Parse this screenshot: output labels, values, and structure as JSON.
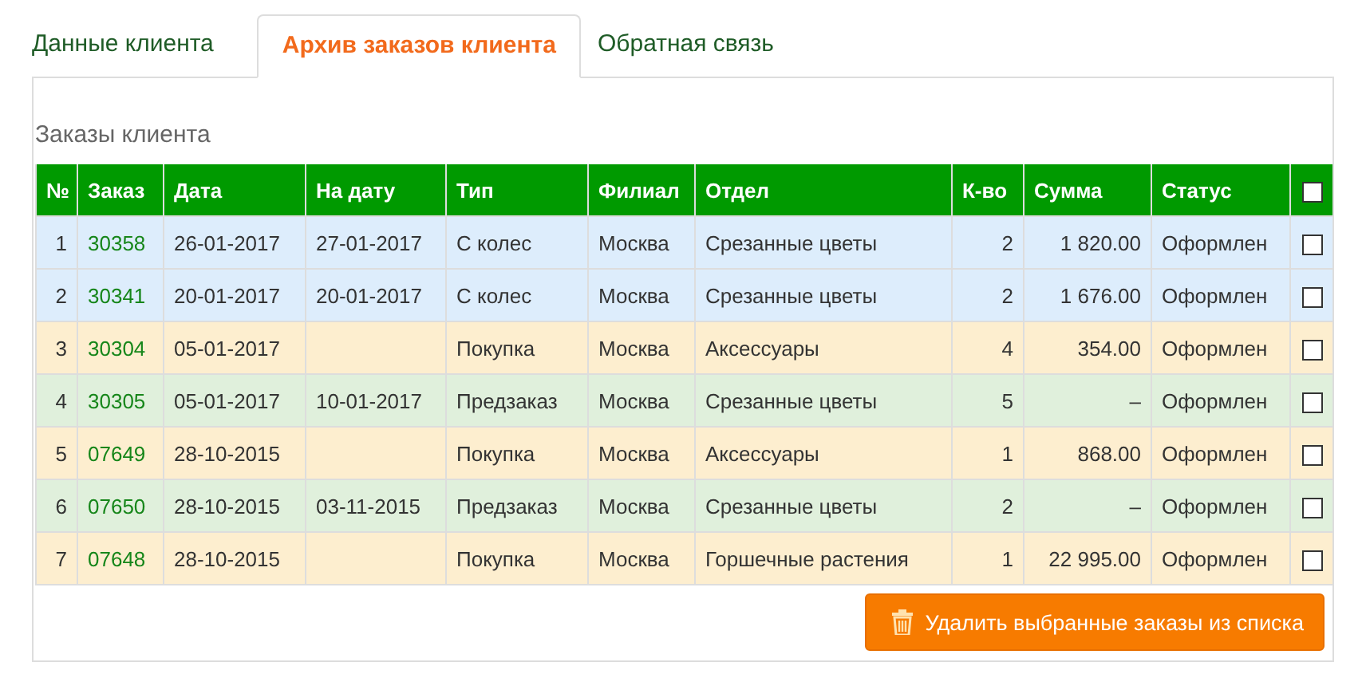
{
  "tabs": [
    {
      "label": "Данные клиента",
      "selected": false
    },
    {
      "label": "Архив заказов клиента",
      "selected": true
    },
    {
      "label": "Обратная связь",
      "selected": false
    }
  ],
  "panel": {
    "title": "Заказы клиента",
    "table": {
      "columns": [
        "№",
        "Заказ",
        "Дата",
        "На дату",
        "Тип",
        "Филиал",
        "Отдел",
        "К-во",
        "Сумма",
        "Статус"
      ],
      "select_all": {
        "checked": false
      },
      "rows": [
        {
          "cells": [
            "1",
            "30358",
            "26-01-2017",
            "27-01-2017",
            "С колес",
            "Москва",
            "Срезанные цветы",
            "2",
            "1 820.00",
            "Оформлен"
          ],
          "color": "#ddedfc",
          "checked": false
        },
        {
          "cells": [
            "2",
            "30341",
            "20-01-2017",
            "20-01-2017",
            "С колес",
            "Москва",
            "Срезанные цветы",
            "2",
            "1 676.00",
            "Оформлен"
          ],
          "color": "#ddedfc",
          "checked": false
        },
        {
          "cells": [
            "3",
            "30304",
            "05-01-2017",
            "",
            "Покупка",
            "Москва",
            "Аксессуары",
            "4",
            "354.00",
            "Оформлен"
          ],
          "color": "#fdeecf",
          "checked": false
        },
        {
          "cells": [
            "4",
            "30305",
            "05-01-2017",
            "10-01-2017",
            "Предзаказ",
            "Москва",
            "Срезанные цветы",
            "5",
            "–",
            "Оформлен"
          ],
          "color": "#e0f0dc",
          "checked": false
        },
        {
          "cells": [
            "5",
            "07649",
            "28-10-2015",
            "",
            "Покупка",
            "Москва",
            "Аксессуары",
            "1",
            "868.00",
            "Оформлен"
          ],
          "color": "#fdeecf",
          "checked": false
        },
        {
          "cells": [
            "6",
            "07650",
            "28-10-2015",
            "03-11-2015",
            "Предзаказ",
            "Москва",
            "Срезанные цветы",
            "2",
            "–",
            "Оформлен"
          ],
          "color": "#e0f0dc",
          "checked": false
        },
        {
          "cells": [
            "7",
            "07648",
            "28-10-2015",
            "",
            "Покупка",
            "Москва",
            "Горшечные растения",
            "1",
            "22 995.00",
            "Оформлен"
          ],
          "color": "#fdeecf",
          "checked": false
        }
      ]
    },
    "delete_button": "Удалить выбранные заказы из списка"
  }
}
